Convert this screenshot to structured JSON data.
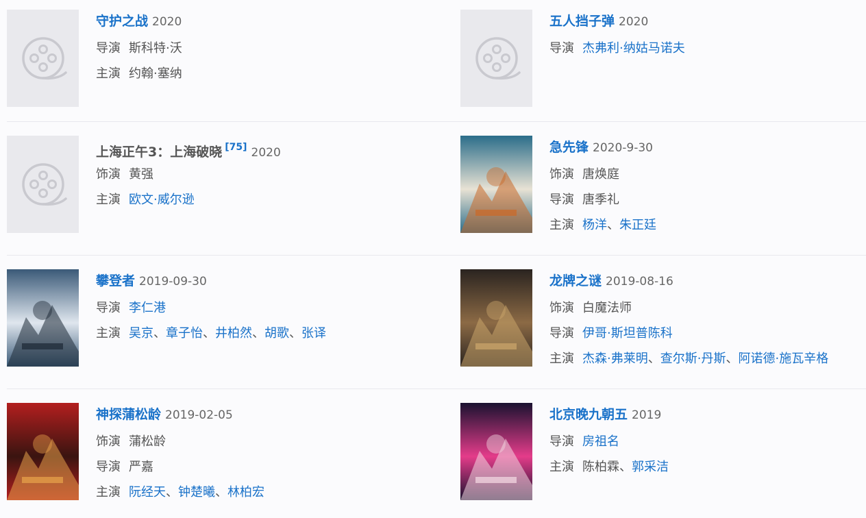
{
  "labels": {
    "director": "导演",
    "cast": "主演",
    "role": "饰演",
    "separator": "、"
  },
  "movies": [
    {
      "title": "守护之战",
      "year": "2020",
      "poster": "placeholder",
      "rows": [
        {
          "label": "导演",
          "names": [
            {
              "text": "斯科特·沃",
              "link": false
            }
          ]
        },
        {
          "label": "主演",
          "names": [
            {
              "text": "约翰·塞纳",
              "link": false
            }
          ]
        }
      ]
    },
    {
      "title": "五人挡子弹",
      "year": "2020",
      "poster": "placeholder",
      "rows": [
        {
          "label": "导演",
          "names": [
            {
              "text": "杰弗利·纳姑马诺夫",
              "link": true
            }
          ]
        }
      ]
    },
    {
      "title": "上海正午3：上海破晓",
      "badge": "[75]",
      "year": "2020",
      "poster": "placeholder",
      "title_gray": true,
      "rows": [
        {
          "label": "饰演",
          "names": [
            {
              "text": "黄强",
              "link": false
            }
          ]
        },
        {
          "label": "主演",
          "names": [
            {
              "text": "欧文·威尔逊",
              "link": true
            }
          ]
        }
      ]
    },
    {
      "title": "急先锋",
      "year": "2020-9-30",
      "poster": "image",
      "poster_colors": [
        "#2b6d8a",
        "#e8e2d4",
        "#c96a2a"
      ],
      "rows": [
        {
          "label": "饰演",
          "names": [
            {
              "text": "唐焕庭",
              "link": false
            }
          ]
        },
        {
          "label": "导演",
          "names": [
            {
              "text": "唐季礼",
              "link": false
            }
          ]
        },
        {
          "label": "主演",
          "names": [
            {
              "text": "杨洋",
              "link": true
            },
            {
              "text": "朱正廷",
              "link": true
            }
          ]
        }
      ]
    },
    {
      "title": "攀登者",
      "year": "2019-09-30",
      "poster": "image",
      "poster_colors": [
        "#3b5a78",
        "#dfe6ee",
        "#1f2b38"
      ],
      "rows": [
        {
          "label": "导演",
          "names": [
            {
              "text": "李仁港",
              "link": true
            }
          ]
        },
        {
          "label": "主演",
          "names": [
            {
              "text": "吴京",
              "link": true
            },
            {
              "text": "章子怡",
              "link": true
            },
            {
              "text": "井柏然",
              "link": true
            },
            {
              "text": "胡歌",
              "link": true
            },
            {
              "text": "张译",
              "link": true
            }
          ]
        }
      ]
    },
    {
      "title": "龙牌之谜",
      "year": "2019-08-16",
      "poster": "image",
      "poster_colors": [
        "#2a2420",
        "#8c6a45",
        "#c9a46a"
      ],
      "rows": [
        {
          "label": "饰演",
          "names": [
            {
              "text": "白魔法师",
              "link": false
            }
          ]
        },
        {
          "label": "导演",
          "names": [
            {
              "text": "伊哥·斯坦普陈科",
              "link": true
            }
          ]
        },
        {
          "label": "主演",
          "names": [
            {
              "text": "杰森·弗莱明",
              "link": true
            },
            {
              "text": "查尔斯·丹斯",
              "link": true
            },
            {
              "text": "阿诺德·施瓦辛格",
              "link": true
            }
          ]
        }
      ]
    },
    {
      "title": "神探蒲松龄",
      "year": "2019-02-05",
      "poster": "image",
      "poster_colors": [
        "#b31f1f",
        "#3a1410",
        "#e6a04a"
      ],
      "rows": [
        {
          "label": "饰演",
          "names": [
            {
              "text": "蒲松龄",
              "link": false
            }
          ]
        },
        {
          "label": "导演",
          "names": [
            {
              "text": "严嘉",
              "link": false
            }
          ]
        },
        {
          "label": "主演",
          "names": [
            {
              "text": "阮经天",
              "link": true
            },
            {
              "text": "钟楚曦",
              "link": true
            },
            {
              "text": "林柏宏",
              "link": true
            }
          ]
        }
      ]
    },
    {
      "title": "北京晚九朝五",
      "year": "2019",
      "poster": "image",
      "poster_colors": [
        "#1a1230",
        "#e43c8a",
        "#f2d6e0"
      ],
      "rows": [
        {
          "label": "导演",
          "names": [
            {
              "text": "房祖名",
              "link": true
            }
          ]
        },
        {
          "label": "主演",
          "names": [
            {
              "text": "陈柏霖",
              "link": false
            },
            {
              "text": "郭采洁",
              "link": true
            }
          ]
        }
      ]
    }
  ]
}
